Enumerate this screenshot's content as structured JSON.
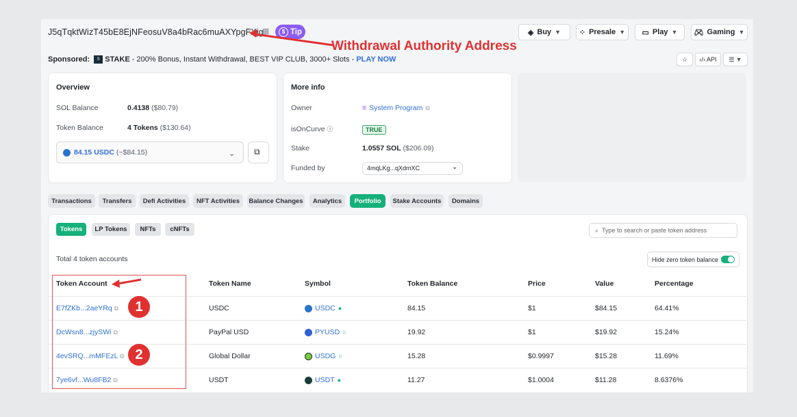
{
  "header": {
    "address": "J5qTqktWizT45bE8EjNFeosuV8a4bRac6muAXYpgFXjg",
    "tip_label": "Tip",
    "annotation": "Withdrawal Authority Address",
    "nav": [
      {
        "label": "Buy",
        "icon": "buy-icon"
      },
      {
        "label": "Presale",
        "icon": "presale-icon"
      },
      {
        "label": "Play",
        "icon": "play-icon"
      },
      {
        "label": "Gaming",
        "icon": "gaming-icon"
      }
    ]
  },
  "sponsored": {
    "prefix": "Sponsored:",
    "brand": "STAKE",
    "text": " - 200% Bonus, Instant Withdrawal, BEST VIP CLUB, 3000+ Slots - ",
    "cta": "PLAY NOW",
    "api_label": "API"
  },
  "overview": {
    "title": "Overview",
    "sol_label": "SOL Balance",
    "sol_value": "0.4138",
    "sol_usd": "($80.79)",
    "token_label": "Token Balance",
    "token_value": "4 Tokens",
    "token_usd": "($130.64)",
    "select_value": "84.15 USDC",
    "select_usd": "(~$84.15)"
  },
  "more_info": {
    "title": "More info",
    "owner_label": "Owner",
    "owner_value": "System Program",
    "oncurve_label": "isOnCurve",
    "oncurve_value": "TRUE",
    "stake_label": "Stake",
    "stake_value": "1.0557 SOL",
    "stake_usd": "($206.09)",
    "funded_label": "Funded by",
    "funded_value": "4mqLKg...qXdmXC"
  },
  "tabs": [
    "Transactions",
    "Transfers",
    "Defi Activities",
    "NFT Activities",
    "Balance Changes",
    "Analytics",
    "Portfolio",
    "Stake Accounts",
    "Domains"
  ],
  "active_tab": "Portfolio",
  "subtabs": [
    "Tokens",
    "LP Tokens",
    "NFTs",
    "cNFTs"
  ],
  "search_placeholder": "Type to search or paste token address",
  "total_text": "Total 4 token accounts",
  "hide_zero_label": "Hide zero token balance",
  "table": {
    "headers": [
      "Token Account",
      "Token Name",
      "Symbol",
      "Token Balance",
      "Price",
      "Value",
      "Percentage"
    ],
    "rows": [
      {
        "account": "E7fZKb...2aeYRq",
        "name": "USDC",
        "symbol": "USDC",
        "balance": "84.15",
        "price": "$1",
        "value": "$84.15",
        "pct": "64.41%"
      },
      {
        "account": "DcWsn8...zjySWi",
        "name": "PayPal USD",
        "symbol": "PYUSD",
        "balance": "19.92",
        "price": "$1",
        "value": "$19.92",
        "pct": "15.24%"
      },
      {
        "account": "4evSRQ...mMFEzL",
        "name": "Global Dollar",
        "symbol": "USDG",
        "balance": "15.28",
        "price": "$0.9997",
        "value": "$15.28",
        "pct": "11.69%"
      },
      {
        "account": "7ye6vf...Wu8FB2",
        "name": "USDT",
        "symbol": "USDT",
        "balance": "11.27",
        "price": "$1.0004",
        "value": "$11.28",
        "pct": "8.6376%"
      }
    ]
  },
  "markers": [
    "1",
    "2"
  ],
  "colors": {
    "accent": "#16b07b",
    "annotation": "#e03131",
    "link": "#2f6fdb"
  }
}
